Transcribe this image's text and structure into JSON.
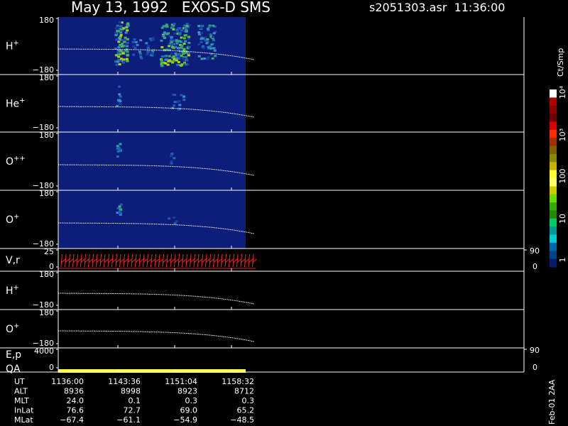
{
  "header": {
    "title": "May 13, 1992   EXOS-D SMS",
    "file_time": "s2051303.asr  11:36:00"
  },
  "colors": {
    "background": "#000000",
    "panel_fill": "#0c1e7a",
    "frame": "#ffffff",
    "trace": "#ffffff",
    "velocity_vectors": "#ff2222",
    "qa_bar": "#ffff33"
  },
  "colorbar": {
    "unit_label": "Ct/Smp",
    "tick_labels": [
      "1",
      "10",
      "100",
      "10³",
      "10⁴"
    ],
    "colors": [
      "#ffffff",
      "#b00000",
      "#8b0000",
      "#6e0000",
      "#d80000",
      "#ff2a00",
      "#a03000",
      "#806000",
      "#8a8a00",
      "#c8b400",
      "#ffff33",
      "#ffff66",
      "#cccc00",
      "#66dd00",
      "#33aa00",
      "#228800",
      "#00cc66",
      "#009999",
      "#00cccc",
      "#0066aa",
      "#004488",
      "#0a1a6a"
    ]
  },
  "panels": [
    {
      "label_base": "H",
      "label_sup": "+",
      "y_top": "180",
      "y_bottom": "−180"
    },
    {
      "label_base": "He",
      "label_sup": "+",
      "y_top": "180",
      "y_bottom": "−180"
    },
    {
      "label_base": "O",
      "label_sup": "++",
      "y_top": "180",
      "y_bottom": "−180"
    },
    {
      "label_base": "O",
      "label_sup": "+",
      "y_top": "180",
      "y_bottom": "−180"
    },
    {
      "label_base": "V,r",
      "label_sup": "",
      "y_top": "25",
      "y_bottom": "0",
      "right_top": "90",
      "right_bottom": "0"
    },
    {
      "label_base": "H",
      "label_sup": "+",
      "y_top": "180",
      "y_bottom": "−180"
    },
    {
      "label_base": "O",
      "label_sup": "+",
      "y_top": "180",
      "y_bottom": "−180"
    },
    {
      "label_base": "E,p",
      "label_sup": "",
      "label2": "QA",
      "y_top": "4000",
      "y_bottom": "0",
      "right_top": "90",
      "right_bottom": "0"
    }
  ],
  "footer": {
    "rows": [
      {
        "name": "UT",
        "values": [
          "1136:00",
          "1143:36",
          "1151:04",
          "1158:32"
        ]
      },
      {
        "name": "ALT",
        "values": [
          "8936",
          "8998",
          "8923",
          "8712"
        ]
      },
      {
        "name": "MLT",
        "values": [
          "24.0",
          "0.1",
          "0.3",
          "0.3"
        ]
      },
      {
        "name": "InLat",
        "values": [
          "76.6",
          "72.7",
          "69.0",
          "65.2"
        ]
      },
      {
        "name": "MLat",
        "values": [
          "−67.4",
          "−61.1",
          "−54.9",
          "−48.5"
        ]
      }
    ],
    "side_note": "Feb-01 2AA"
  },
  "chart_data": {
    "type": "heatmap",
    "time_ticks": [
      "1136:00",
      "1143:36",
      "1151:04",
      "1158:32"
    ],
    "pitch_angle_range": [
      -180,
      180
    ],
    "data_coverage_end_fraction": 0.79,
    "log_scale_colorbar": true,
    "colorbar_range": [
      1,
      10000
    ]
  }
}
